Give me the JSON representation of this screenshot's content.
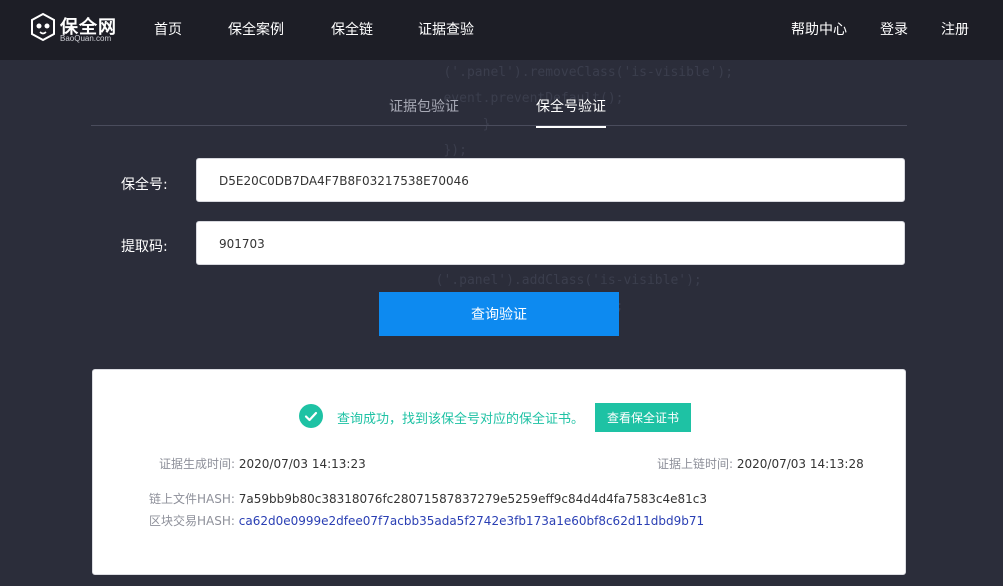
{
  "colors": {
    "topbar": "#1d1e26",
    "background": "#2b2d3a",
    "primary": "#0d8af0",
    "success": "#1ec2a4",
    "link": "#2a3fb4"
  },
  "logo": {
    "name": "保全网",
    "sub": "BaoQuan.com",
    "icon": "panda-logo-icon"
  },
  "nav": {
    "left": [
      "首页",
      "保全案例",
      "保全链",
      "证据查验"
    ],
    "help": "帮助中心",
    "login": "登录",
    "register": "注册"
  },
  "tabs": [
    {
      "label": "证据包验证",
      "active": false
    },
    {
      "label": "保全号验证",
      "active": true
    }
  ],
  "form": {
    "baoquan_label": "保全号:",
    "baoquan_value": "D5E20C0DB7DA4F7B8F03217538E70046",
    "code_label": "提取码:",
    "code_value": "901703",
    "submit": "查询验证"
  },
  "result": {
    "icon": "check-circle-icon",
    "message": "查询成功，找到该保全号对应的保全证书。",
    "view_cert": "查看保全证书",
    "gen_time_label": "证据生成时间:",
    "gen_time": "2020/07/03 14:13:23",
    "chain_time_label": "证据上链时间:",
    "chain_time": "2020/07/03 14:13:28",
    "file_hash_label": "链上文件HASH:",
    "file_hash": "7a59bb9b80c38318076fc28071587837279e5259eff9c84d4d4fa7583c4e81c3",
    "tx_hash_label": "区块交易HASH:",
    "tx_hash": "ca62d0e0999e2dfee07f7acbb35ada5f2742e3fb173a1e60bf8c62d11dbd9b71"
  }
}
